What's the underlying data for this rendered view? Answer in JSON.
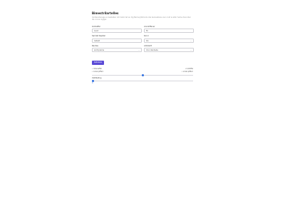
{
  "form": {
    "title": "Bimestrilartelles",
    "description": "Verdienstenage en bestellen ivit mehrcret an dig Bemscytisfunds olle bersneblans vier oruit ie etat. Sema discunter dis conce ingiger."
  },
  "fields": [
    {
      "label": "Ginhaffel",
      "value": "Ivnnt",
      "type": "text"
    },
    {
      "label": "Anniziffener",
      "value": "ftl",
      "type": "text"
    },
    {
      "label": "Samlet Kapital",
      "value": "Ivstext",
      "type": "text"
    },
    {
      "label": "Kornr",
      "value": "Ikn",
      "type": "select"
    },
    {
      "label": "Rentes",
      "value": "Arntcpreme",
      "type": "select"
    },
    {
      "label": "Ambladt",
      "value": "Unni danhede",
      "type": "select"
    }
  ],
  "submit_label": "Kalkulare",
  "legend": {
    "left": [
      "• Interseffel",
      "• Lirxal pifferc"
    ],
    "right": [
      "• Inntsffel",
      "• Lirxal pifferc"
    ]
  },
  "slider1": {
    "fraction": 0.5
  },
  "slider2": {
    "label": "Valdibeting",
    "value": "0",
    "fraction": 0.0
  }
}
